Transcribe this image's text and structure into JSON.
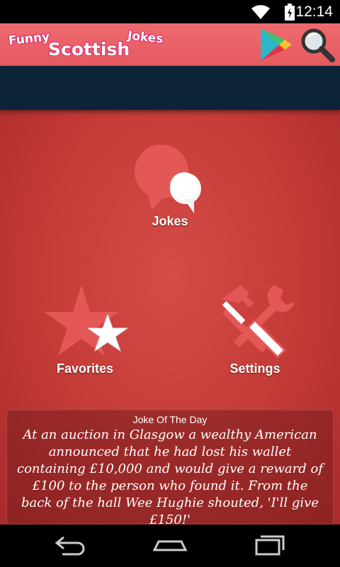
{
  "status": {
    "time": "12:14"
  },
  "app": {
    "title_words": [
      "Funny",
      "Scottish",
      "Jokes"
    ]
  },
  "menu": {
    "jokes_label": "Jokes",
    "favorites_label": "Favorites",
    "settings_label": "Settings"
  },
  "joke_of_day": {
    "title": "Joke Of The Day",
    "text": "At an auction in Glasgow a wealthy American announced that he had lost his wallet containing £10,000 and would give a reward of £100 to the person who found it. From the back of the hall Wee Hughie shouted, 'I'll give £150!'"
  },
  "icons": {
    "play": "google-play-icon",
    "search": "magnifier-icon",
    "jokes": "speech-bubbles-icon",
    "favorites": "stars-icon",
    "settings": "tools-icon"
  },
  "colors": {
    "action_bar": "#e55a60",
    "background": "#c33a37",
    "banner": "#0d2338",
    "logo_stroke": "#d8266e"
  }
}
